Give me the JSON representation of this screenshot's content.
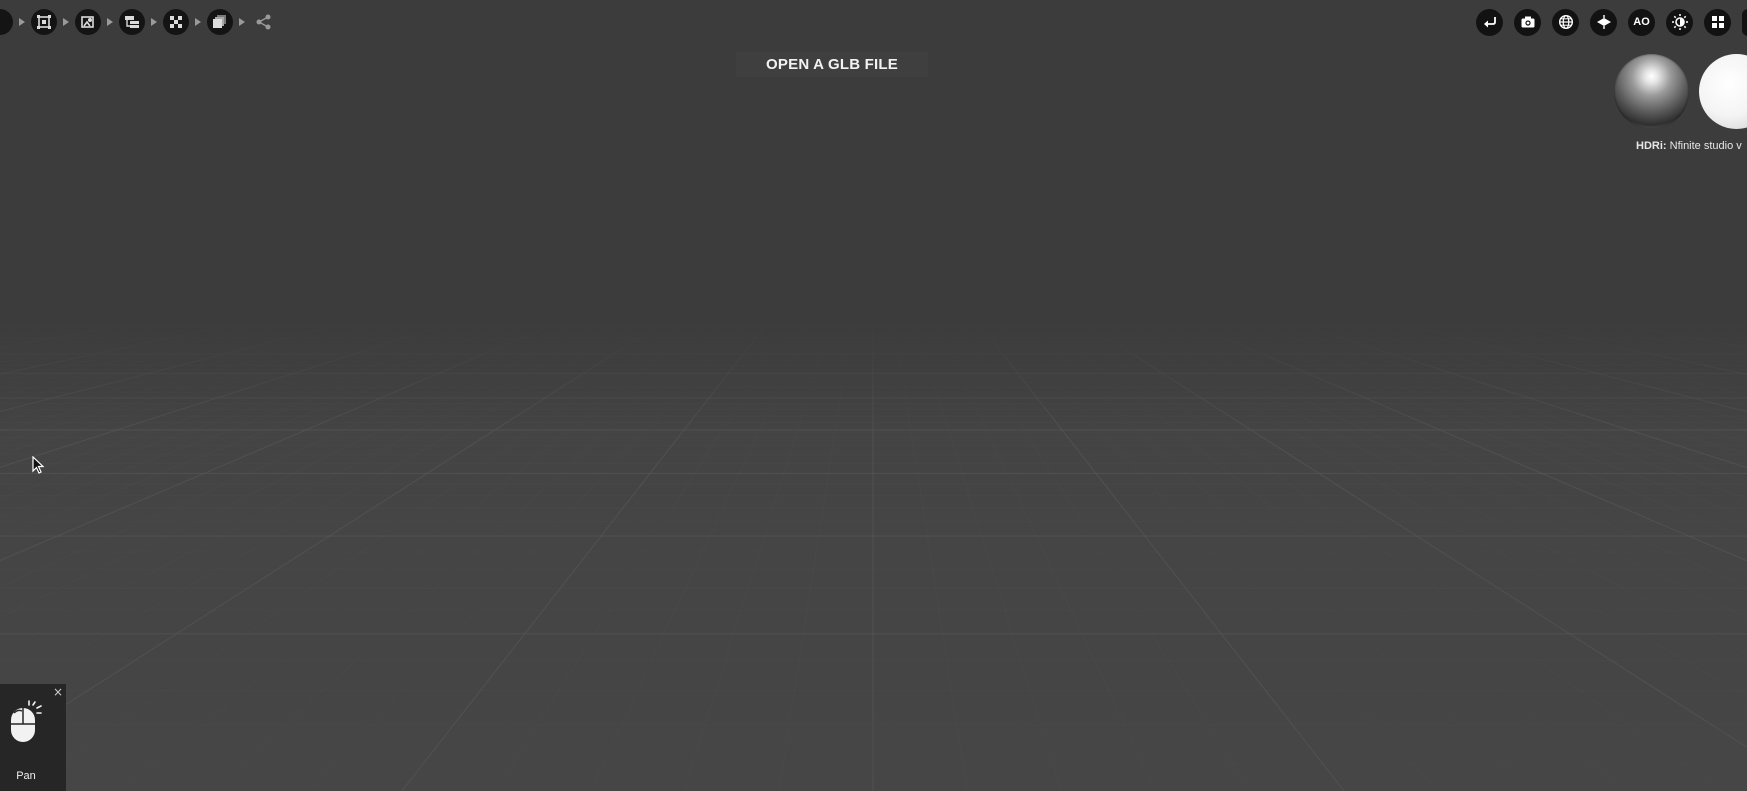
{
  "viewport": {
    "background_top": "#3b3b3b",
    "floor_color": "#474747",
    "grid_line_color": "#5a5a5a"
  },
  "workflow_steps": [
    {
      "icon": "partial-step-icon"
    },
    {
      "icon": "frame-select-icon"
    },
    {
      "icon": "texture-import-icon"
    },
    {
      "icon": "hierarchy-icon"
    },
    {
      "icon": "checker-material-icon"
    },
    {
      "icon": "layers-icon"
    },
    {
      "icon": "share-icon"
    }
  ],
  "open_glb": {
    "label": "OPEN A GLB FILE"
  },
  "toolbar": [
    {
      "icon": "undo-icon"
    },
    {
      "icon": "camera-icon"
    },
    {
      "icon": "globe-icon"
    },
    {
      "icon": "ground-plane-icon"
    },
    {
      "icon": "ao-icon",
      "label": "AO"
    },
    {
      "icon": "brightness-icon"
    },
    {
      "icon": "grid-layout-icon"
    },
    {
      "icon": "overflow-icon"
    }
  ],
  "hdri": {
    "label": "HDRi:",
    "value": "Nfinite studio v"
  },
  "hint": {
    "close": "×",
    "icon": "mouse-pan-icon",
    "label": "Pan"
  }
}
